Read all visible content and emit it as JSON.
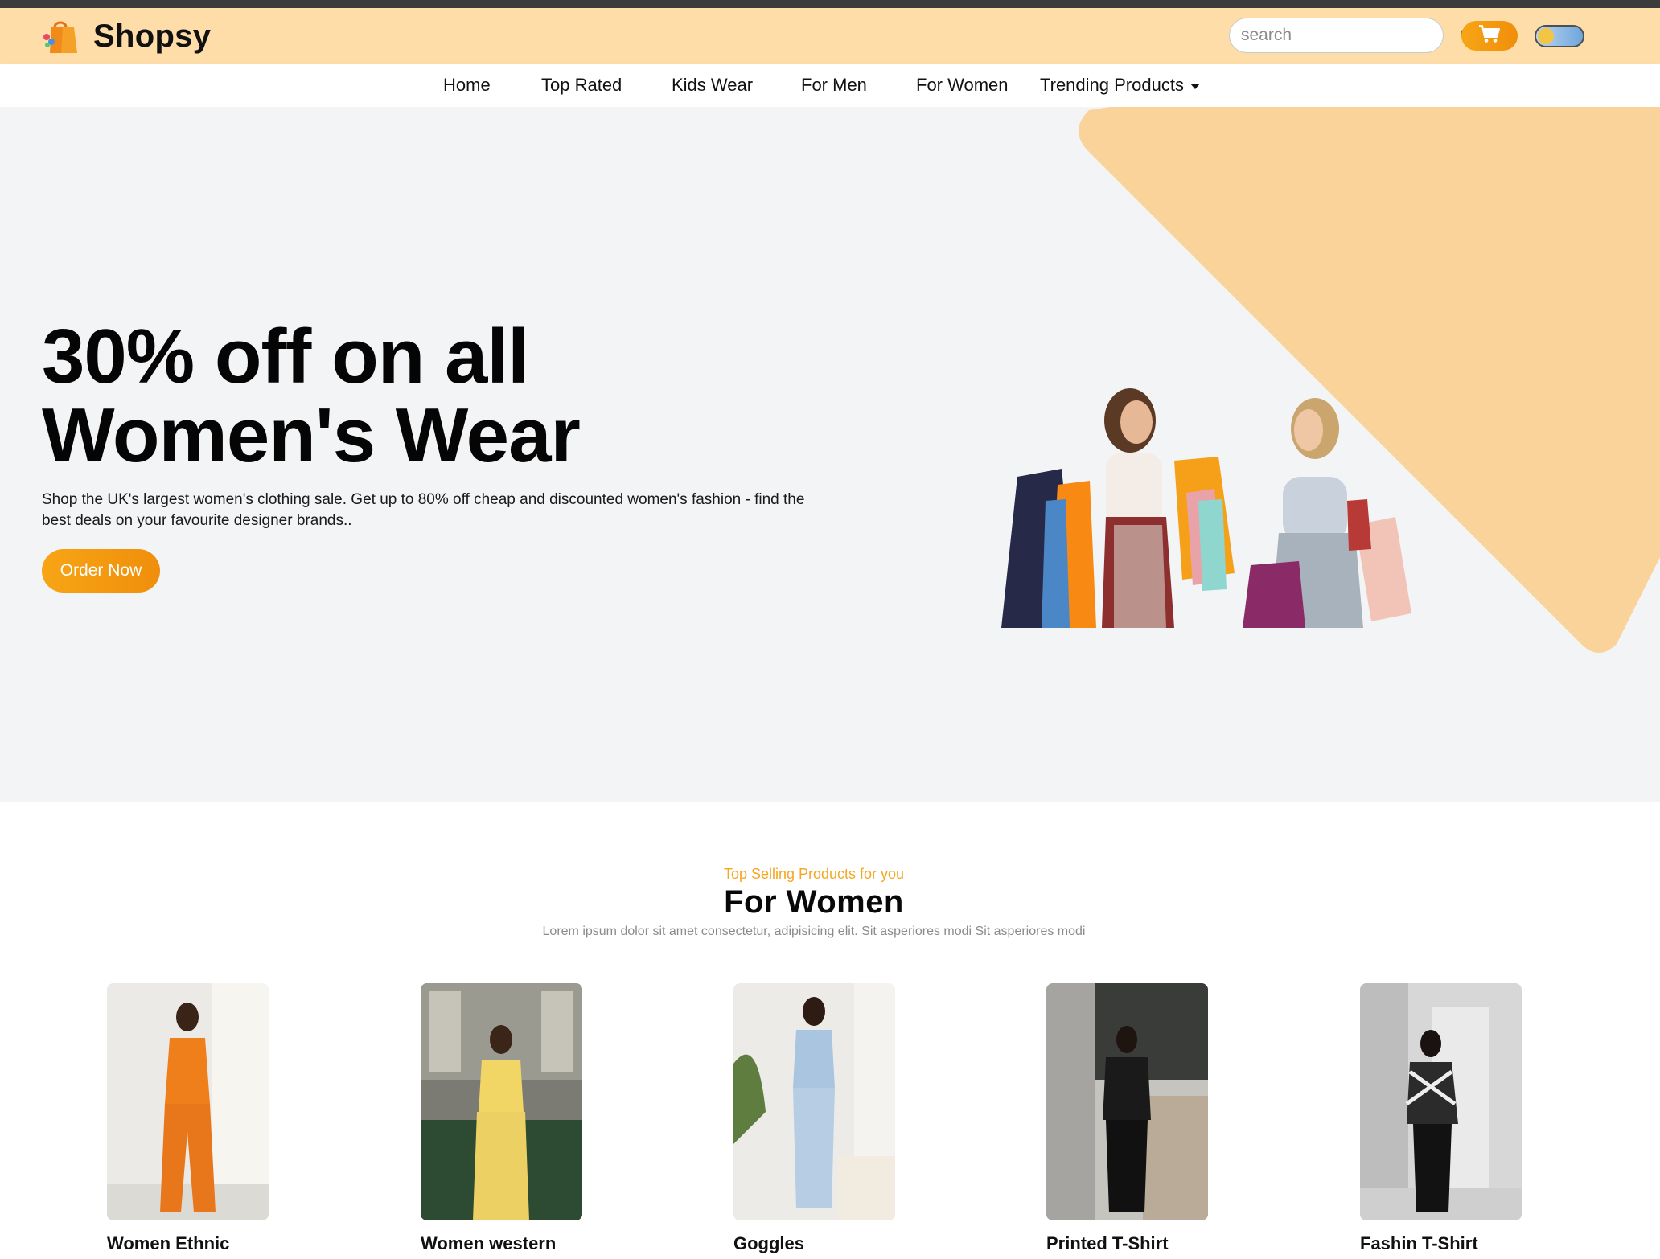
{
  "app": {
    "brand": "Shopsy",
    "brand_icon": "shopping-bag-icon"
  },
  "header": {
    "search_placeholder": "search",
    "search_icon": "search-icon",
    "cart_icon": "cart-icon",
    "theme_toggle": "dark-mode-toggle",
    "colors": {
      "header_bg": "#fedda9",
      "accent": "#f7a515"
    }
  },
  "nav": {
    "items": [
      {
        "label": "Home"
      },
      {
        "label": "Top Rated"
      },
      {
        "label": "Kids Wear"
      },
      {
        "label": "For Men"
      },
      {
        "label": "For Women"
      },
      {
        "label": "Trending Products",
        "dropdown": true
      }
    ]
  },
  "hero": {
    "title": "30% off on all Women's Wear",
    "description": "Shop the UK's largest women's clothing sale. Get up to 80% off cheap and discounted women's fashion - find the best deals on your favourite designer brands..",
    "cta_label": "Order Now"
  },
  "section": {
    "subtitle": "Top Selling Products for you",
    "title": "For Women",
    "description": "Lorem ipsum dolor sit amet consectetur, adipisicing elit. Sit asperiores modi Sit asperiores modi"
  },
  "products": [
    {
      "name": "Women Ethnic",
      "outfit_color": "#ee7f1a"
    },
    {
      "name": "Women western",
      "outfit_color": "#f1d565"
    },
    {
      "name": "Goggles",
      "outfit_color": "#a9c5e0"
    },
    {
      "name": "Printed T-Shirt",
      "outfit_color": "#1a1a1a"
    },
    {
      "name": "Fashin T-Shirt",
      "outfit_color": "#2b2b2b"
    }
  ]
}
